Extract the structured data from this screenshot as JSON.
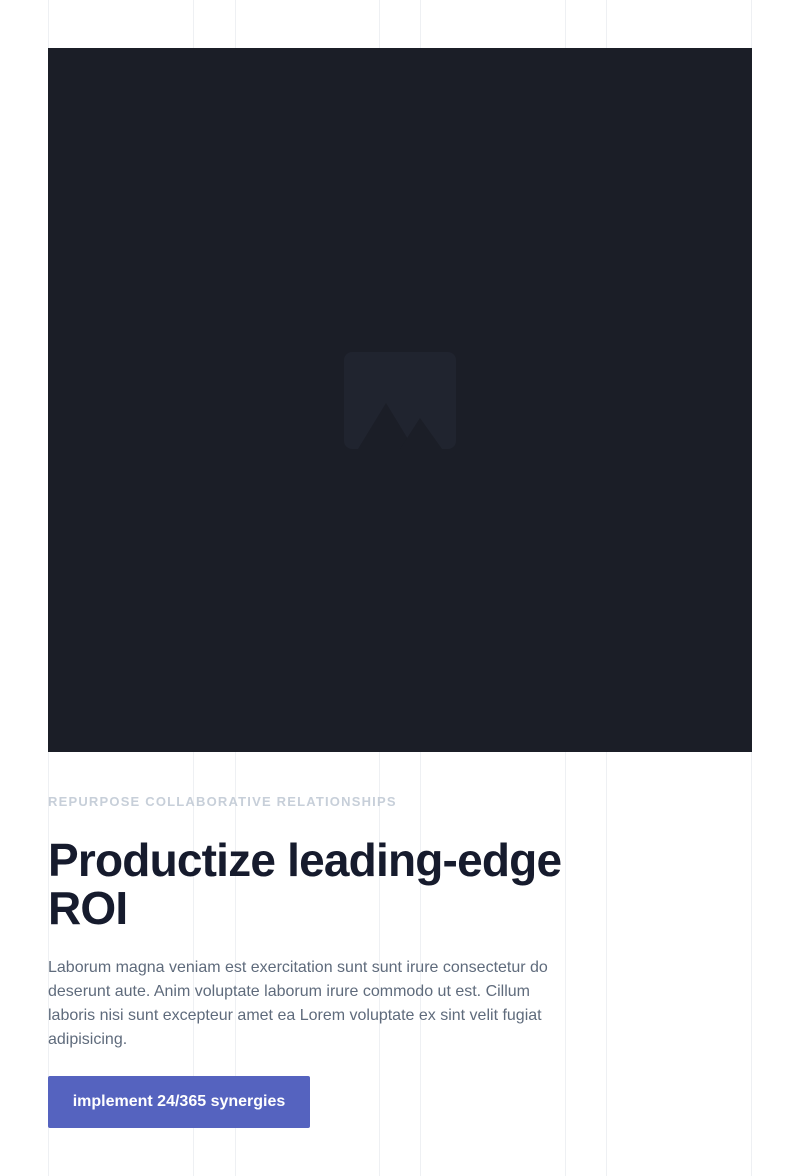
{
  "hero": {
    "image": {
      "icon": "image-placeholder-icon"
    }
  },
  "content": {
    "eyebrow": "REPURPOSE COLLABORATIVE RELATIONSHIPS",
    "title": "Productize leading-edge ROI",
    "body": "Laborum magna veniam est exercitation sunt sunt irure consectetur do deserunt aute. Anim voluptate laborum irure commodo ut est. Cillum laboris nisi sunt excepteur amet ea Lorem voluptate ex sint velit fugiat adipisicing.",
    "cta_label": "implement 24/365 synergies"
  },
  "colors": {
    "background": "#ffffff",
    "hero": "#1b1e27",
    "placeholder": "#20242f",
    "accent": "#5563bf",
    "heading": "#161b2d",
    "body": "#5f6b7c",
    "eyebrow": "#c7cfd9",
    "grid": "#eef0f3"
  }
}
